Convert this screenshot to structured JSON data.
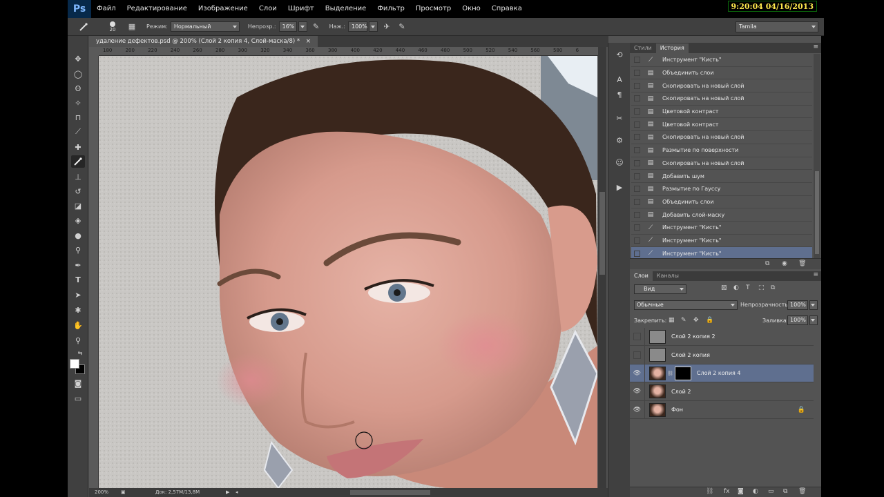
{
  "clock": "9:20:04  04/16/2013",
  "app": {
    "logo": "Ps"
  },
  "menu": [
    "Файл",
    "Редактирование",
    "Изображение",
    "Слои",
    "Шрифт",
    "Выделение",
    "Фильтр",
    "Просмотр",
    "Окно",
    "Справка"
  ],
  "options": {
    "brush_size": "20",
    "mode_label": "Режим:",
    "mode_value": "Нормальный",
    "opacity_label": "Непрозр.:",
    "opacity_value": "16%",
    "flow_label": "Наж.:",
    "flow_value": "100%",
    "workspace": "Tamila"
  },
  "document": {
    "tab_title": "удаление дефектов.psd @ 200% (Слой 2 копия 4, Слой-маска/8) *",
    "tab_close": "×",
    "ruler_ticks": [
      "180",
      "200",
      "220",
      "240",
      "260",
      "280",
      "300",
      "320",
      "340",
      "360",
      "380",
      "400",
      "420",
      "440",
      "460",
      "480",
      "500",
      "520",
      "540",
      "560",
      "580",
      "6"
    ],
    "zoom": "200%",
    "doc_info": "Док: 2,57М/13,8М"
  },
  "history_panel": {
    "tabs": [
      "Стили",
      "История"
    ],
    "active_tab": "История",
    "items": [
      {
        "label": "Инструмент \"Кисть\"",
        "icon": "brush-icon"
      },
      {
        "label": "Объединить слои",
        "icon": "document-icon"
      },
      {
        "label": "Скопировать на новый слой",
        "icon": "document-icon"
      },
      {
        "label": "Скопировать на новый слой",
        "icon": "document-icon"
      },
      {
        "label": "Цветовой контраст",
        "icon": "document-icon"
      },
      {
        "label": "Цветовой контраст",
        "icon": "document-icon"
      },
      {
        "label": "Скопировать на новый слой",
        "icon": "document-icon"
      },
      {
        "label": "Размытие по поверхности",
        "icon": "document-icon"
      },
      {
        "label": "Скопировать на новый слой",
        "icon": "document-icon"
      },
      {
        "label": "Добавить шум",
        "icon": "document-icon"
      },
      {
        "label": "Размытие по Гауссу",
        "icon": "document-icon"
      },
      {
        "label": "Объединить слои",
        "icon": "document-icon"
      },
      {
        "label": "Добавить слой-маску",
        "icon": "document-icon"
      },
      {
        "label": "Инструмент \"Кисть\"",
        "icon": "brush-icon"
      },
      {
        "label": "Инструмент \"Кисть\"",
        "icon": "brush-icon"
      },
      {
        "label": "Инструмент \"Кисть\"",
        "icon": "brush-icon"
      }
    ],
    "selected_index": 15
  },
  "layers_panel": {
    "tabs": [
      "Слои",
      "Каналы"
    ],
    "active_tab": "Слои",
    "filter": "Вид",
    "blend_mode": "Обычные",
    "opacity_label": "Непрозрачность:",
    "opacity_value": "100%",
    "lock_label": "Закрепить:",
    "fill_label": "Заливка:",
    "fill_value": "100%",
    "layers": [
      {
        "name": "Слой 2 копия 2",
        "visible": false,
        "thumb": "gray"
      },
      {
        "name": "Слой 2 копия",
        "visible": false,
        "thumb": "gray"
      },
      {
        "name": "Слой 2 копия 4",
        "visible": true,
        "thumb": "face",
        "mask": true
      },
      {
        "name": "Слой 2",
        "visible": true,
        "thumb": "face"
      },
      {
        "name": "Фон",
        "visible": true,
        "thumb": "face",
        "locked": true
      }
    ],
    "selected_index": 2
  },
  "colors": {
    "accent_selection": "#5f6f8f",
    "menubar": "#000000",
    "panel": "#535353",
    "clock_text": "#ffe94d"
  }
}
